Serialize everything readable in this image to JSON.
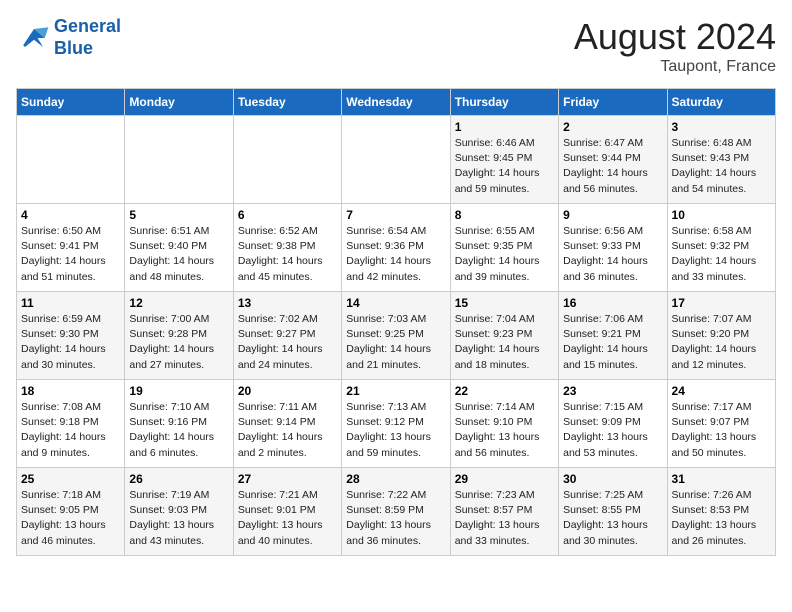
{
  "header": {
    "logo_line1": "General",
    "logo_line2": "Blue",
    "month_title": "August 2024",
    "location": "Taupont, France"
  },
  "weekdays": [
    "Sunday",
    "Monday",
    "Tuesday",
    "Wednesday",
    "Thursday",
    "Friday",
    "Saturday"
  ],
  "weeks": [
    [
      {
        "day": "",
        "info": ""
      },
      {
        "day": "",
        "info": ""
      },
      {
        "day": "",
        "info": ""
      },
      {
        "day": "",
        "info": ""
      },
      {
        "day": "1",
        "info": "Sunrise: 6:46 AM\nSunset: 9:45 PM\nDaylight: 14 hours and 59 minutes."
      },
      {
        "day": "2",
        "info": "Sunrise: 6:47 AM\nSunset: 9:44 PM\nDaylight: 14 hours and 56 minutes."
      },
      {
        "day": "3",
        "info": "Sunrise: 6:48 AM\nSunset: 9:43 PM\nDaylight: 14 hours and 54 minutes."
      }
    ],
    [
      {
        "day": "4",
        "info": "Sunrise: 6:50 AM\nSunset: 9:41 PM\nDaylight: 14 hours and 51 minutes."
      },
      {
        "day": "5",
        "info": "Sunrise: 6:51 AM\nSunset: 9:40 PM\nDaylight: 14 hours and 48 minutes."
      },
      {
        "day": "6",
        "info": "Sunrise: 6:52 AM\nSunset: 9:38 PM\nDaylight: 14 hours and 45 minutes."
      },
      {
        "day": "7",
        "info": "Sunrise: 6:54 AM\nSunset: 9:36 PM\nDaylight: 14 hours and 42 minutes."
      },
      {
        "day": "8",
        "info": "Sunrise: 6:55 AM\nSunset: 9:35 PM\nDaylight: 14 hours and 39 minutes."
      },
      {
        "day": "9",
        "info": "Sunrise: 6:56 AM\nSunset: 9:33 PM\nDaylight: 14 hours and 36 minutes."
      },
      {
        "day": "10",
        "info": "Sunrise: 6:58 AM\nSunset: 9:32 PM\nDaylight: 14 hours and 33 minutes."
      }
    ],
    [
      {
        "day": "11",
        "info": "Sunrise: 6:59 AM\nSunset: 9:30 PM\nDaylight: 14 hours and 30 minutes."
      },
      {
        "day": "12",
        "info": "Sunrise: 7:00 AM\nSunset: 9:28 PM\nDaylight: 14 hours and 27 minutes."
      },
      {
        "day": "13",
        "info": "Sunrise: 7:02 AM\nSunset: 9:27 PM\nDaylight: 14 hours and 24 minutes."
      },
      {
        "day": "14",
        "info": "Sunrise: 7:03 AM\nSunset: 9:25 PM\nDaylight: 14 hours and 21 minutes."
      },
      {
        "day": "15",
        "info": "Sunrise: 7:04 AM\nSunset: 9:23 PM\nDaylight: 14 hours and 18 minutes."
      },
      {
        "day": "16",
        "info": "Sunrise: 7:06 AM\nSunset: 9:21 PM\nDaylight: 14 hours and 15 minutes."
      },
      {
        "day": "17",
        "info": "Sunrise: 7:07 AM\nSunset: 9:20 PM\nDaylight: 14 hours and 12 minutes."
      }
    ],
    [
      {
        "day": "18",
        "info": "Sunrise: 7:08 AM\nSunset: 9:18 PM\nDaylight: 14 hours and 9 minutes."
      },
      {
        "day": "19",
        "info": "Sunrise: 7:10 AM\nSunset: 9:16 PM\nDaylight: 14 hours and 6 minutes."
      },
      {
        "day": "20",
        "info": "Sunrise: 7:11 AM\nSunset: 9:14 PM\nDaylight: 14 hours and 2 minutes."
      },
      {
        "day": "21",
        "info": "Sunrise: 7:13 AM\nSunset: 9:12 PM\nDaylight: 13 hours and 59 minutes."
      },
      {
        "day": "22",
        "info": "Sunrise: 7:14 AM\nSunset: 9:10 PM\nDaylight: 13 hours and 56 minutes."
      },
      {
        "day": "23",
        "info": "Sunrise: 7:15 AM\nSunset: 9:09 PM\nDaylight: 13 hours and 53 minutes."
      },
      {
        "day": "24",
        "info": "Sunrise: 7:17 AM\nSunset: 9:07 PM\nDaylight: 13 hours and 50 minutes."
      }
    ],
    [
      {
        "day": "25",
        "info": "Sunrise: 7:18 AM\nSunset: 9:05 PM\nDaylight: 13 hours and 46 minutes."
      },
      {
        "day": "26",
        "info": "Sunrise: 7:19 AM\nSunset: 9:03 PM\nDaylight: 13 hours and 43 minutes."
      },
      {
        "day": "27",
        "info": "Sunrise: 7:21 AM\nSunset: 9:01 PM\nDaylight: 13 hours and 40 minutes."
      },
      {
        "day": "28",
        "info": "Sunrise: 7:22 AM\nSunset: 8:59 PM\nDaylight: 13 hours and 36 minutes."
      },
      {
        "day": "29",
        "info": "Sunrise: 7:23 AM\nSunset: 8:57 PM\nDaylight: 13 hours and 33 minutes."
      },
      {
        "day": "30",
        "info": "Sunrise: 7:25 AM\nSunset: 8:55 PM\nDaylight: 13 hours and 30 minutes."
      },
      {
        "day": "31",
        "info": "Sunrise: 7:26 AM\nSunset: 8:53 PM\nDaylight: 13 hours and 26 minutes."
      }
    ]
  ]
}
